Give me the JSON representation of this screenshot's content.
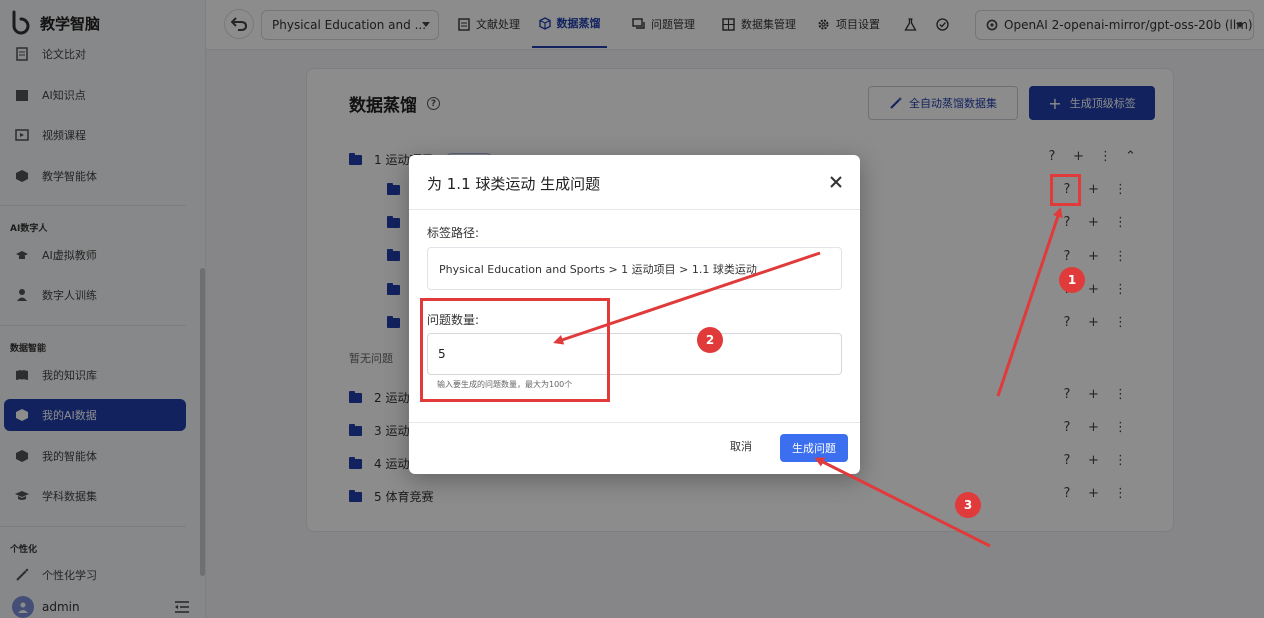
{
  "app": {
    "logo_text": "教学智脑"
  },
  "sidebar": {
    "items": [
      {
        "label": "论文比对",
        "icon": "document-compare-icon"
      },
      {
        "label": "AI知识点",
        "icon": "clapperboard-icon"
      },
      {
        "label": "视频课程",
        "icon": "video-icon"
      },
      {
        "label": "教学智能体",
        "icon": "cube-icon"
      },
      {
        "label": "AI虚拟教师",
        "icon": "teacher-icon"
      },
      {
        "label": "数字人训练",
        "icon": "person-icon"
      },
      {
        "label": "我的知识库",
        "icon": "book-icon"
      },
      {
        "label": "我的AI数据",
        "icon": "cube-icon"
      },
      {
        "label": "我的智能体",
        "icon": "cube-icon"
      },
      {
        "label": "学科数据集",
        "icon": "graduation-cap-icon"
      },
      {
        "label": "个性化学习",
        "icon": "wand-icon"
      }
    ],
    "sections": {
      "digital_human": "AI数字人",
      "data_intel": "数据智能",
      "personalize": "个性化"
    },
    "user": {
      "name": "admin"
    },
    "active_color": "#1f3fae"
  },
  "header": {
    "project": "Physical Education and ...",
    "tabs": [
      {
        "label": "文献处理",
        "icon": "file-icon"
      },
      {
        "label": "数据蒸馏",
        "icon": "cube-icon"
      },
      {
        "label": "问题管理",
        "icon": "chat-icon"
      },
      {
        "label": "数据集管理",
        "icon": "grid-icon"
      },
      {
        "label": "项目设置",
        "icon": "gear-icon"
      }
    ],
    "active_tab": "数据蒸馏",
    "model": "OpenAI 2-openai-mirror/gpt-oss-20b (llm)"
  },
  "main": {
    "title": "数据蒸馏",
    "auto_button": "全自动蒸馏数据集",
    "gen_button": "生成顶级标签",
    "tree": [
      {
        "label": "1 运动项目"
      },
      {
        "label": ""
      },
      {
        "label": ""
      },
      {
        "label": ""
      },
      {
        "label": ""
      },
      {
        "label": ""
      },
      {
        "label": "2 运动"
      },
      {
        "label": "3 运动"
      },
      {
        "label": "4 运动"
      },
      {
        "label": "5 体育竞赛"
      }
    ],
    "empty_text": "暂无问题",
    "actions": {
      "question": "?",
      "add": "+",
      "more": "⋮",
      "collapse": "⌃"
    }
  },
  "dialog": {
    "title": "为 1.1 球类运动 生成问题",
    "path_label": "标签路径:",
    "path_value": "Physical Education and Sports > 1 运动项目 > 1.1 球类运动",
    "count_label": "问题数量:",
    "count_value": "5",
    "helper": "输入要生成的问题数量，最大为100个",
    "cancel": "取消",
    "confirm": "生成问题"
  },
  "annotations": {
    "one": "1",
    "two": "2",
    "three": "3",
    "color": "#e03a3a"
  }
}
